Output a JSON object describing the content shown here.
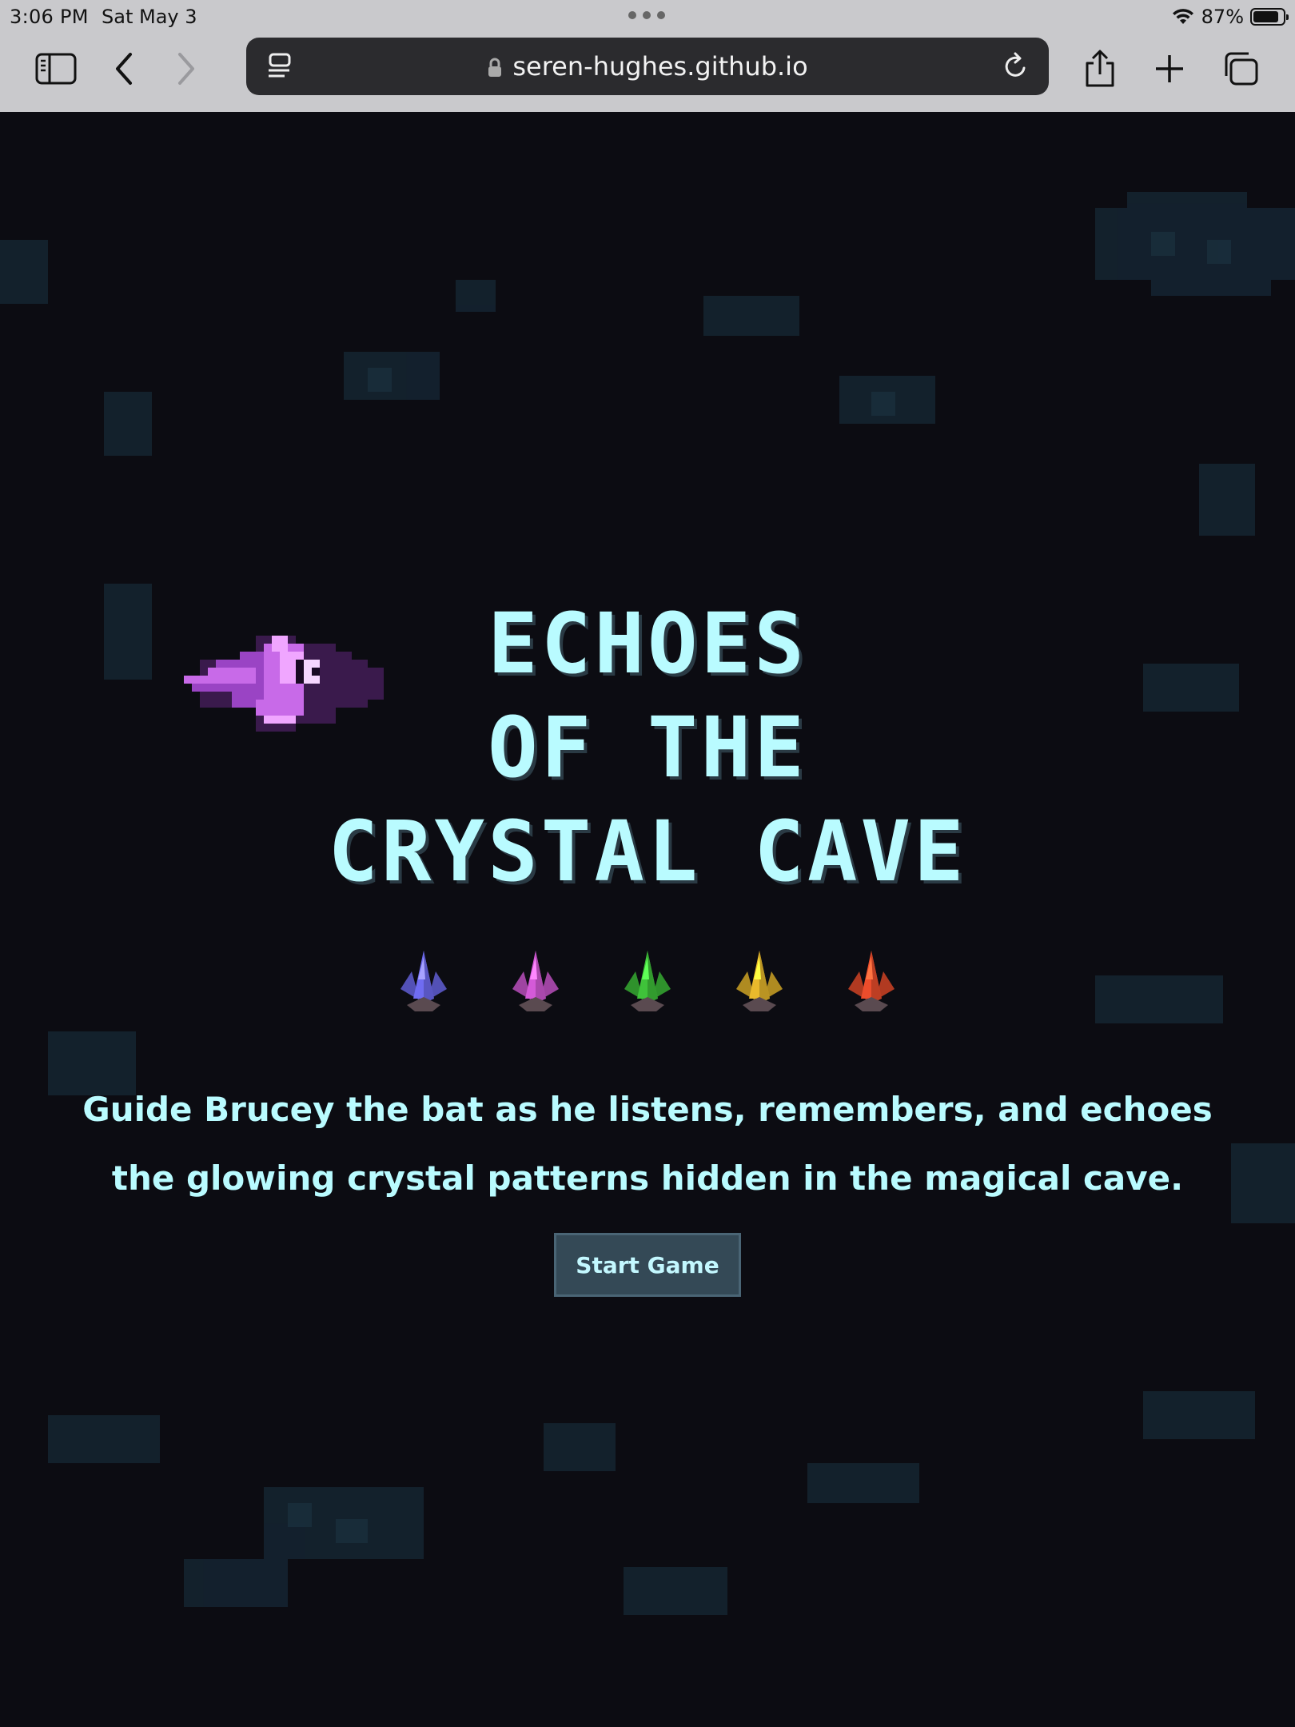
{
  "status_bar": {
    "time": "3:06 PM",
    "date": "Sat May 3",
    "battery": "87%",
    "battery_level": 0.87,
    "icons": [
      "wifi-icon",
      "battery-icon"
    ]
  },
  "browser": {
    "url": "seren-hughes.github.io",
    "toolbar_icons": [
      "sidebar-icon",
      "back-icon",
      "forward-icon",
      "reader-icon",
      "lock-icon",
      "reload-icon",
      "share-icon",
      "new-tab-icon",
      "tabs-icon"
    ]
  },
  "game": {
    "title_lines": [
      "ECHOES",
      "OF THE",
      "CRYSTAL CAVE"
    ],
    "subtitle_lines": [
      "Guide Brucey the bat as he listens, remembers, and echoes",
      "the glowing crystal patterns hidden in the magical cave."
    ],
    "start_label": "Start Game",
    "crystals": [
      {
        "name": "blue-crystal",
        "color": "#6f6cf2"
      },
      {
        "name": "purple-crystal",
        "color": "#d45ad8"
      },
      {
        "name": "green-crystal",
        "color": "#3fc23a"
      },
      {
        "name": "yellow-crystal",
        "color": "#e9b92c"
      },
      {
        "name": "red-crystal",
        "color": "#ec4d2c"
      }
    ],
    "colors": {
      "background": "#0c0c12",
      "text": "#b9fbff",
      "button": "#344956",
      "bat": "#c86ae8"
    }
  }
}
